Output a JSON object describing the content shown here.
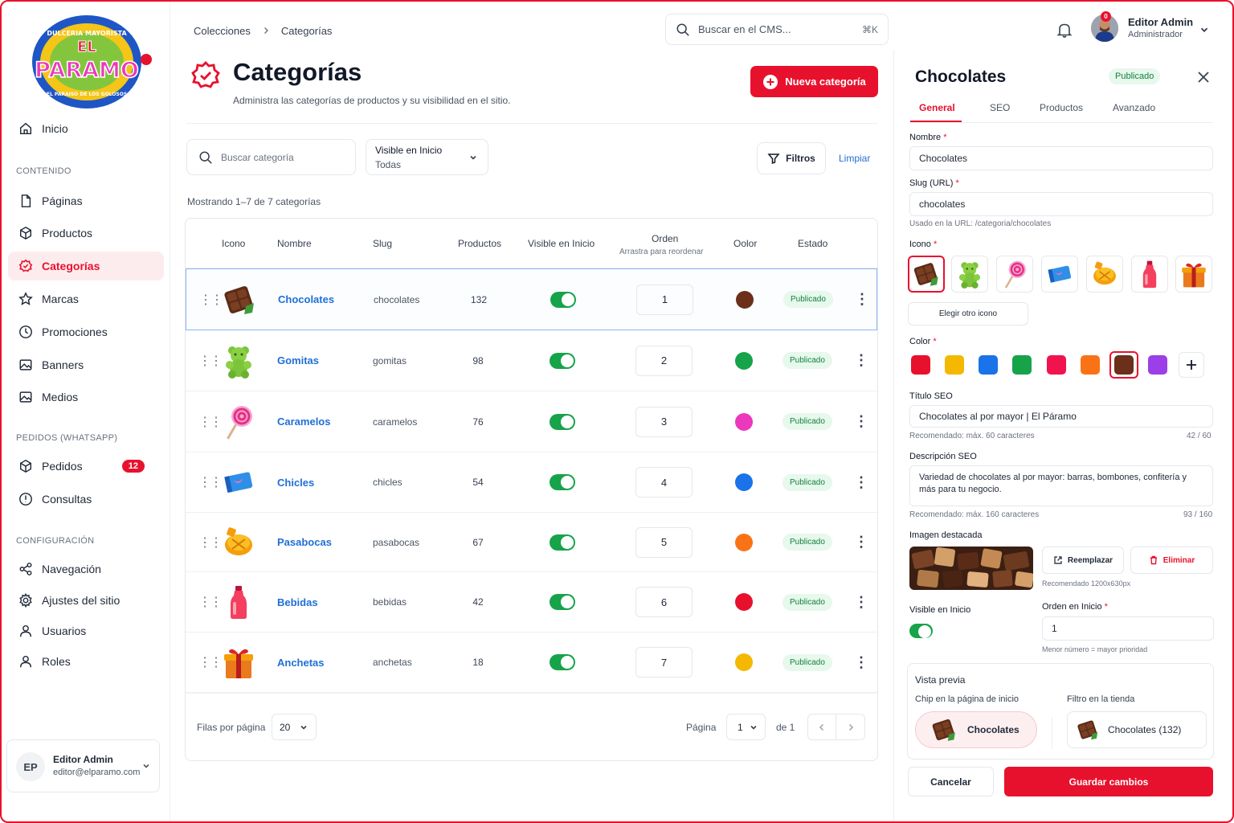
{
  "brand": {
    "logo_top": "DULCERIA MAYORISTA",
    "logo_main": "EL PARAMO",
    "logo_bottom": "EL PARAISO DE LOS GOLOSOS",
    "accent": "#e8112d"
  },
  "sidebar": {
    "home": "Inicio",
    "section_content": "CONTENIDO",
    "content_items": [
      {
        "label": "Páginas",
        "icon": "page-icon"
      },
      {
        "label": "Productos",
        "icon": "box-icon"
      },
      {
        "label": "Categorías",
        "icon": "badge-check-icon"
      },
      {
        "label": "Marcas",
        "icon": "star-icon"
      },
      {
        "label": "Promociones",
        "icon": "clock-icon"
      },
      {
        "label": "Banners",
        "icon": "image-icon"
      },
      {
        "label": "Medios",
        "icon": "image-icon"
      }
    ],
    "section_orders": "PEDIDOS (WHATSAPP)",
    "orders_items": [
      {
        "label": "Pedidos",
        "badge": "12"
      },
      {
        "label": "Consultas"
      }
    ],
    "section_config": "CONFIGURACIÓN",
    "config_items": [
      {
        "label": "Navegación"
      },
      {
        "label": "Ajustes del sitio"
      },
      {
        "label": "Usuarios"
      },
      {
        "label": "Roles"
      }
    ],
    "user": {
      "initials": "EP",
      "name": "Editor Admin",
      "email": "editor@elparamo.com"
    }
  },
  "topbar": {
    "breadcrumb": [
      "Colecciones",
      "Categorías"
    ],
    "search_placeholder": "Buscar en el CMS...",
    "shortcut": "⌘K",
    "notif_count": "0",
    "user_name": "Editor Admin",
    "user_role": "Administrador"
  },
  "header": {
    "title": "Categorías",
    "subtitle": "Administra las categorías de productos y su visibilidad en el sitio.",
    "new_button": "Nueva categoría"
  },
  "filters": {
    "search_placeholder": "Buscar categoría",
    "visible_label": "Visible en Inicio",
    "visible_value": "Todas",
    "filters_button": "Filtros",
    "clear_link": "Limpiar"
  },
  "showing": "Mostrando 1–7 de 7 categorías",
  "table": {
    "headers": {
      "icon": "Icono",
      "name": "Nombre",
      "slug": "Slug",
      "products": "Productos",
      "visible": "Visible en Inicio",
      "order": "Orden",
      "order_sub": "Arrastra para reordenar",
      "color": "Oolor",
      "status": "Estado"
    },
    "rows": [
      {
        "name": "Chocolates",
        "slug": "chocolates",
        "products": "132",
        "order": "1",
        "color": "#6b2f1a",
        "status": "Publicado",
        "visible": true,
        "icon": "chocolate-icon"
      },
      {
        "name": "Gomitas",
        "slug": "gomitas",
        "products": "98",
        "order": "2",
        "color": "#16a34a",
        "status": "Publicado",
        "visible": true,
        "icon": "gummy-bear-icon"
      },
      {
        "name": "Caramelos",
        "slug": "caramelos",
        "products": "76",
        "order": "3",
        "color": "#ec38bc",
        "status": "Publicado",
        "visible": true,
        "icon": "lollipop-icon"
      },
      {
        "name": "Chicles",
        "slug": "chicles",
        "products": "54",
        "order": "4",
        "color": "#1a73e8",
        "status": "Publicado",
        "visible": true,
        "icon": "gum-icon"
      },
      {
        "name": "Pasabocas",
        "slug": "pasabocas",
        "products": "67",
        "order": "5",
        "color": "#f97316",
        "status": "Publicado",
        "visible": true,
        "icon": "snack-icon"
      },
      {
        "name": "Bebidas",
        "slug": "bebidas",
        "products": "42",
        "order": "6",
        "color": "#e8112d",
        "status": "Publicado",
        "visible": true,
        "icon": "bottle-icon"
      },
      {
        "name": "Anchetas",
        "slug": "anchetas",
        "products": "18",
        "order": "7",
        "color": "#f5b800",
        "status": "Publicado",
        "visible": true,
        "icon": "gift-icon"
      }
    ]
  },
  "pagination": {
    "rows_label": "Filas por página",
    "rows_value": "20",
    "page_label": "Página",
    "page_value": "1",
    "of_label": "de 1"
  },
  "panel": {
    "title": "Chocolates",
    "status": "Publicado",
    "tabs": [
      "General",
      "SEO",
      "Productos",
      "Avanzado"
    ],
    "name_label": "Nombre",
    "name_value": "Chocolates",
    "slug_label": "Slug (URL)",
    "slug_value": "chocolates",
    "slug_hint": "Usado en la URL: /categoria/chocolates",
    "icon_label": "Icono",
    "choose_icon": "Elegir otro icono",
    "color_label": "Color",
    "colors": [
      "#e8112d",
      "#f5b800",
      "#1a73e8",
      "#16a34a",
      "#f0134d",
      "#f97316",
      "#6b2f1a",
      "#9b3fe8"
    ],
    "seo_title_label": "Título SEO",
    "seo_title_value": "Chocolates al por mayor | El Páramo",
    "seo_title_hint": "Recomendado: máx. 60 caracteres",
    "seo_title_count": "42 / 60",
    "seo_desc_label": "Descripción SEO",
    "seo_desc_value": "Variedad de chocolates al por mayor: barras, bombones, confitería y más para tu negocio.",
    "seo_desc_hint": "Recomendado: máx. 160 caracteres",
    "seo_desc_count": "93 / 160",
    "image_label": "Imagen destacada",
    "replace": "Reemplazar",
    "delete": "Eliminar",
    "image_hint": "Recomendado 1200x630px",
    "visible_label": "Visible en Inicio",
    "order_label": "Orden en Inicio",
    "order_value": "1",
    "order_hint": "Menor número = mayor prioridad",
    "preview_title": "Vista previa",
    "preview_chip_label": "Chip en la página de inicio",
    "preview_filter_label": "Filtro en la tienda",
    "preview_chip": "Chocolates",
    "preview_filter": "Chocolates (132)",
    "cancel": "Cancelar",
    "save": "Guardar cambios"
  }
}
